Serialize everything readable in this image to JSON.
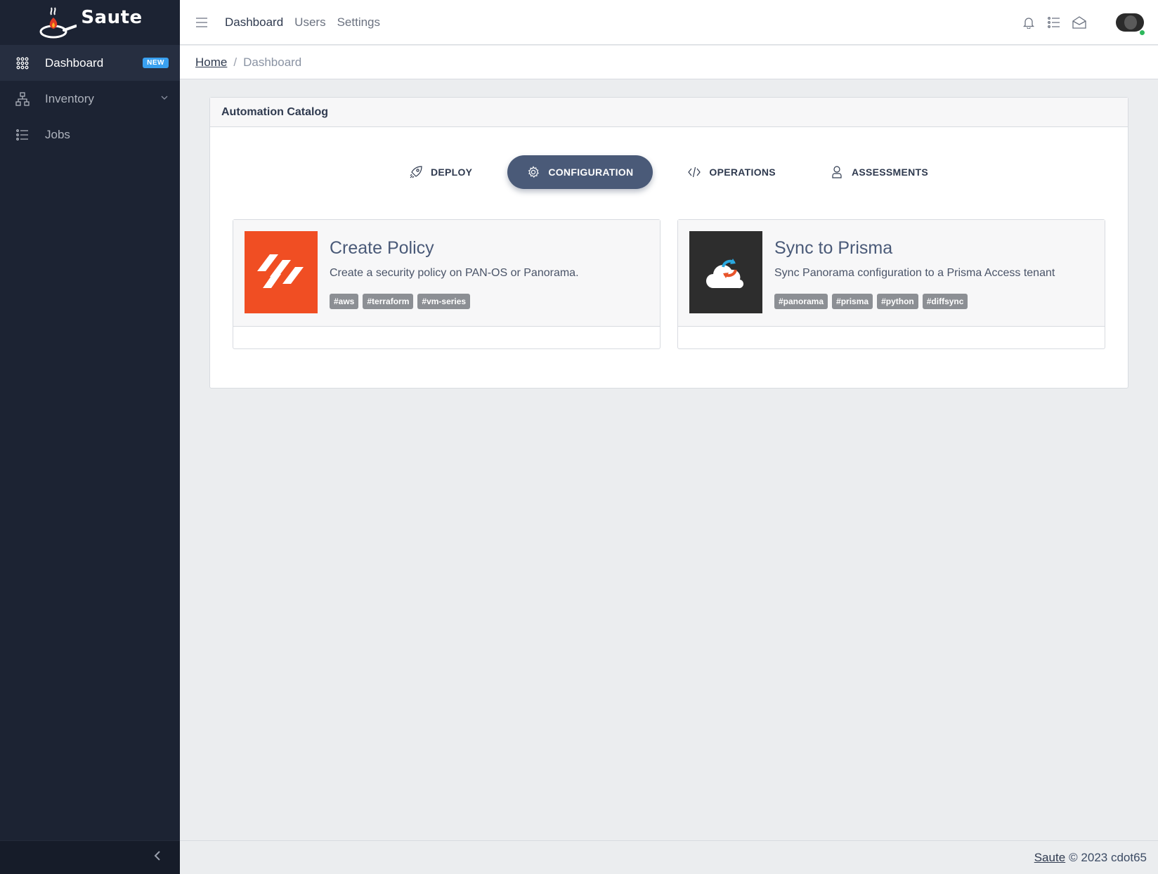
{
  "brand": {
    "name": "Saute"
  },
  "sidebar": {
    "items": [
      {
        "label": "Dashboard",
        "badge": "NEW",
        "icon": "apps-grid-icon",
        "active": true
      },
      {
        "label": "Inventory",
        "icon": "sitemap-icon",
        "has_children": true
      },
      {
        "label": "Jobs",
        "icon": "list-icon"
      }
    ],
    "toggler_icon": "chevron-left-icon"
  },
  "header": {
    "nav": [
      "Dashboard",
      "Users",
      "Settings"
    ],
    "icons": [
      "bell-icon",
      "task-list-icon",
      "envelope-open-icon"
    ],
    "user_status": "online"
  },
  "breadcrumb": {
    "home": "Home",
    "current": "Dashboard"
  },
  "catalog": {
    "title": "Automation Catalog",
    "tabs": [
      {
        "label": "DEPLOY",
        "icon": "rocket-icon"
      },
      {
        "label": "CONFIGURATION",
        "icon": "gear-icon",
        "active": true
      },
      {
        "label": "OPERATIONS",
        "icon": "code-icon"
      },
      {
        "label": "ASSESSMENTS",
        "icon": "user-icon"
      }
    ],
    "cards": [
      {
        "title": "Create Policy",
        "description": "Create a security policy on PAN-OS or Panorama.",
        "tags": [
          "#aws",
          "#terraform",
          "#vm-series"
        ],
        "image": "paloalto-logo",
        "image_bg": "#f04e23"
      },
      {
        "title": "Sync to Prisma",
        "description": "Sync Panorama configuration to a Prisma Access tenant",
        "tags": [
          "#panorama",
          "#prisma",
          "#python",
          "#diffsync"
        ],
        "image": "cloud-sync-icon",
        "image_bg": "#2d2d2d"
      }
    ]
  },
  "footer": {
    "link": "Saute",
    "text": "© 2023 cdot65"
  },
  "colors": {
    "sidebar_bg": "#1c2333",
    "accent": "#4a5a78",
    "badge": "#39a0f0",
    "tag": "#8c8f94"
  }
}
